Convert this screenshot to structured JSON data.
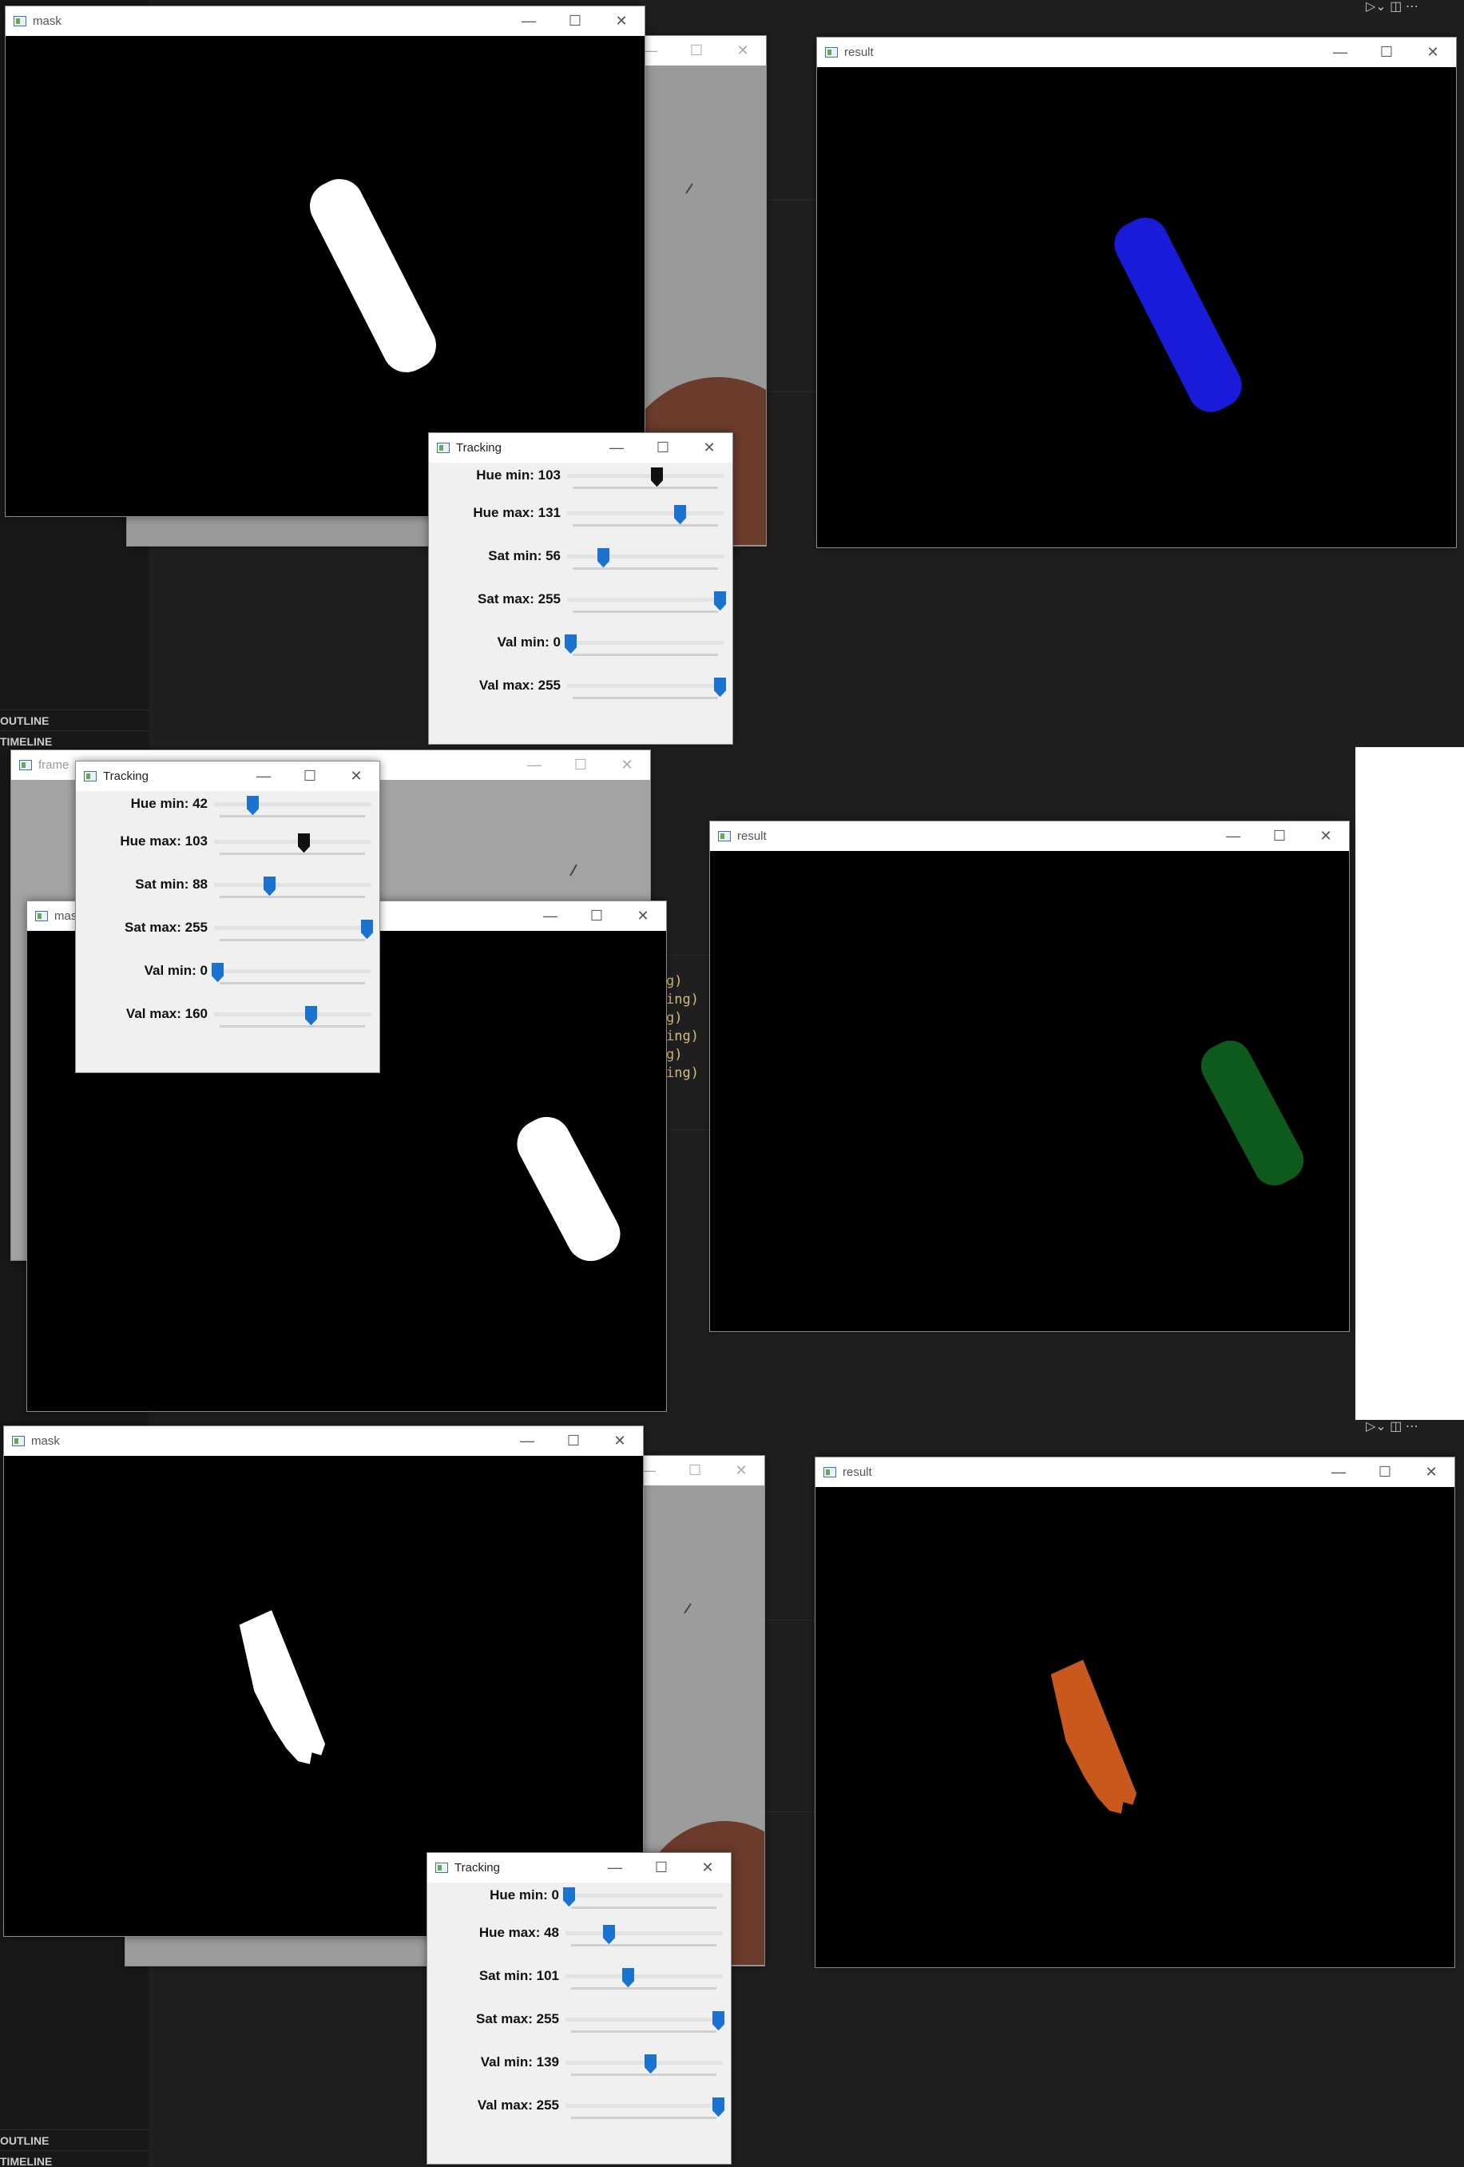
{
  "background": {
    "sidebar_labels": [
      "OUTLINE",
      "TIMELINE"
    ],
    "code_snippets": [
      "g)",
      "ing)",
      "g)",
      "ing)",
      "g)",
      "ing)"
    ],
    "colors": {
      "editor_bg": "#1f1f1f",
      "sidebar_bg": "#181818",
      "code_text": "#d7ba7d"
    }
  },
  "panels": [
    {
      "windows": {
        "mask": {
          "title": "mask",
          "object_color": "#ffffff"
        },
        "frame": {
          "title": ""
        },
        "result": {
          "title": "result",
          "object_color": "#1a1ad9"
        },
        "tracking": {
          "title": "Tracking",
          "trackbars": [
            {
              "label": "Hue min: 103",
              "value": 103,
              "max": 179,
              "active": true
            },
            {
              "label": "Hue max: 131",
              "value": 131,
              "max": 179,
              "active": false
            },
            {
              "label": "Sat min: 56",
              "value": 56,
              "max": 255,
              "active": false
            },
            {
              "label": "Sat max: 255",
              "value": 255,
              "max": 255,
              "active": false
            },
            {
              "label": "Val min: 0",
              "value": 0,
              "max": 255,
              "active": false
            },
            {
              "label": "Val max: 255",
              "value": 255,
              "max": 255,
              "active": false
            }
          ]
        }
      }
    },
    {
      "windows": {
        "frame": {
          "title": "frame"
        },
        "mask": {
          "title": "mas"
        },
        "result": {
          "title": "result",
          "object_color": "#0d5a1c"
        },
        "tracking": {
          "title": "Tracking",
          "trackbars": [
            {
              "label": "Hue min: 42",
              "value": 42,
              "max": 179,
              "active": false
            },
            {
              "label": "Hue max: 103",
              "value": 103,
              "max": 179,
              "active": true
            },
            {
              "label": "Sat min: 88",
              "value": 88,
              "max": 255,
              "active": false
            },
            {
              "label": "Sat max: 255",
              "value": 255,
              "max": 255,
              "active": false
            },
            {
              "label": "Val min: 0",
              "value": 0,
              "max": 255,
              "active": false
            },
            {
              "label": "Val max: 160",
              "value": 160,
              "max": 255,
              "active": false
            }
          ]
        }
      }
    },
    {
      "windows": {
        "mask": {
          "title": "mask",
          "object_color": "#ffffff"
        },
        "frame": {
          "title": ""
        },
        "result": {
          "title": "result",
          "object_color": "#c8581e"
        },
        "tracking": {
          "title": "Tracking",
          "trackbars": [
            {
              "label": "Hue min: 0",
              "value": 0,
              "max": 179,
              "active": false
            },
            {
              "label": "Hue max: 48",
              "value": 48,
              "max": 179,
              "active": false
            },
            {
              "label": "Sat min: 101",
              "value": 101,
              "max": 255,
              "active": false
            },
            {
              "label": "Sat max: 255",
              "value": 255,
              "max": 255,
              "active": false
            },
            {
              "label": "Val min: 139",
              "value": 139,
              "max": 255,
              "active": false
            },
            {
              "label": "Val max: 255",
              "value": 255,
              "max": 255,
              "active": false
            }
          ]
        }
      }
    }
  ],
  "trackbar_colors": {
    "active": "#111111",
    "normal": "#1a73d0"
  }
}
